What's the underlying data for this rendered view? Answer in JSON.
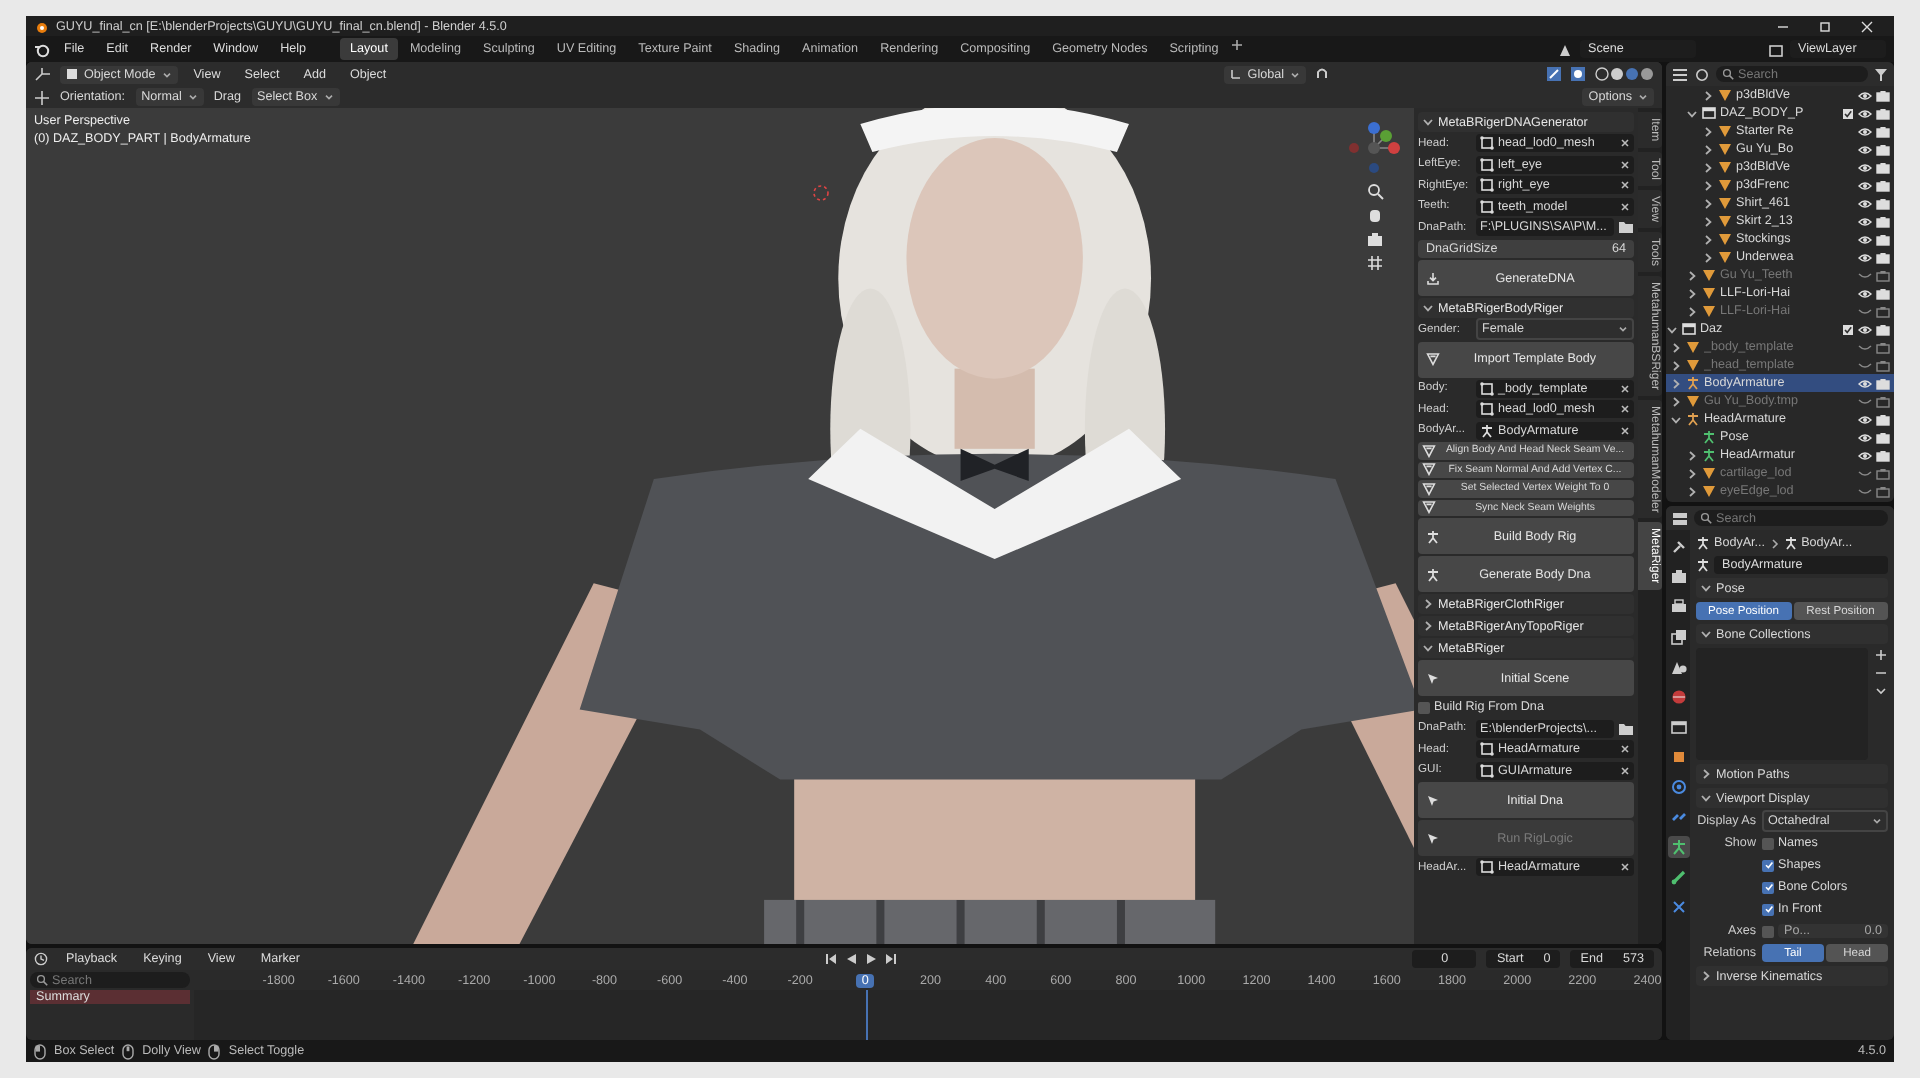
{
  "window": {
    "title": "GUYU_final_cn [E:\\blenderProjects\\GUYU\\GUYU_final_cn.blend] - Blender 4.5.0"
  },
  "menu": [
    "File",
    "Edit",
    "Render",
    "Window",
    "Help"
  ],
  "workspaces": [
    {
      "label": "Layout",
      "selected": true
    },
    {
      "label": "Modeling",
      "selected": false
    },
    {
      "label": "Sculpting",
      "selected": false
    },
    {
      "label": "UV Editing",
      "selected": false
    },
    {
      "label": "Texture Paint",
      "selected": false
    },
    {
      "label": "Shading",
      "selected": false
    },
    {
      "label": "Animation",
      "selected": false
    },
    {
      "label": "Rendering",
      "selected": false
    },
    {
      "label": "Compositing",
      "selected": false
    },
    {
      "label": "Geometry Nodes",
      "selected": false
    },
    {
      "label": "Scripting",
      "selected": false
    }
  ],
  "scene": "Scene",
  "view_layer": "ViewLayer",
  "viewport": {
    "mode": "Object Mode",
    "menus": [
      "View",
      "Select",
      "Add",
      "Object"
    ],
    "orientation": "Global",
    "options": "Options",
    "tool_settings": {
      "orientation_label": "Orientation:",
      "orientation": "Normal",
      "drag_label": "Drag",
      "drag": "Select Box"
    },
    "overlay": [
      "User Perspective",
      "(0) DAZ_BODY_PART | BodyArmature"
    ]
  },
  "side_tabs": [
    {
      "label": "Item",
      "selected": false
    },
    {
      "label": "Tool",
      "selected": false
    },
    {
      "label": "View",
      "selected": false
    },
    {
      "label": "Tools",
      "selected": false
    },
    {
      "label": "MetahumanBSRiger",
      "selected": false
    },
    {
      "label": "MetahumanModeler",
      "selected": false
    },
    {
      "label": "MetaRiger",
      "selected": true
    }
  ],
  "n_panel": [
    {
      "title": "MetaBRigerDNAGenerator",
      "expanded": true,
      "rows": [
        {
          "kind": "mesh_field",
          "label": "Head:",
          "value": "head_lod0_mesh"
        },
        {
          "kind": "mesh_field",
          "label": "LeftEye:",
          "value": "left_eye"
        },
        {
          "kind": "mesh_field",
          "label": "RightEye:",
          "value": "right_eye"
        },
        {
          "kind": "mesh_field",
          "label": "Teeth:",
          "value": "teeth_model"
        },
        {
          "kind": "path",
          "label": "DnaPath:",
          "value": "F:\\PLUGINS\\SA\\P\\M..."
        },
        {
          "kind": "number",
          "label": "DnaGridSize",
          "value": "64"
        },
        {
          "kind": "import_button",
          "label": "GenerateDNA",
          "disabled": false
        }
      ]
    },
    {
      "title": "MetaBRigerBodyRiger",
      "expanded": true,
      "rows": [
        {
          "kind": "dropdown",
          "label": "Gender:",
          "value": "Female"
        },
        {
          "kind": "mesh_button",
          "label": "Import Template Body",
          "disabled": false
        },
        {
          "kind": "mesh_field",
          "label": "Body:",
          "value": "_body_template"
        },
        {
          "kind": "mesh_field",
          "label": "Head:",
          "value": "head_lod0_mesh"
        },
        {
          "kind": "armature_field",
          "label": "BodyAr...",
          "value": "BodyArmature"
        },
        {
          "kind": "small_button",
          "label": "Align Body And Head Neck Seam Ve..."
        },
        {
          "kind": "small_button",
          "label": "Fix Seam Normal And Add Vertex C..."
        },
        {
          "kind": "small_button",
          "label": "Set Selected Vertex Weight To 0"
        },
        {
          "kind": "small_button",
          "label": "Sync Neck Seam Weights"
        },
        {
          "kind": "armature_button",
          "label": "Build Body Rig",
          "disabled": false
        },
        {
          "kind": "armature_button",
          "label": "Generate Body Dna",
          "disabled": false
        }
      ]
    },
    {
      "title": "MetaBRigerClothRiger",
      "expanded": false
    },
    {
      "title": "MetaBRigerAnyTopoRiger",
      "expanded": false
    },
    {
      "title": "MetaBRiger",
      "expanded": true,
      "rows": [
        {
          "kind": "pointer_button",
          "label": "Initial Scene",
          "disabled": false
        },
        {
          "kind": "checkbox",
          "label": "Build Rig From Dna",
          "checked": false
        },
        {
          "kind": "path",
          "label": "DnaPath:",
          "value": "E:\\blenderProjects\\..."
        },
        {
          "kind": "mesh_field",
          "label": "Head:",
          "value": "HeadArmature"
        },
        {
          "kind": "mesh_field",
          "label": "GUI:",
          "value": "GUIArmature"
        },
        {
          "kind": "pointer_button",
          "label": "Initial Dna",
          "disabled": false
        },
        {
          "kind": "pointer_button",
          "label": "Run RigLogic",
          "disabled": true
        },
        {
          "kind": "mesh_field",
          "label": "HeadAr...",
          "value": "HeadArmature"
        }
      ]
    }
  ],
  "outliner": {
    "search_placeholder": "Search",
    "tree": [
      {
        "children": [
          {
            "children": [
              {
                "children": [
                  {
                    "name": "p3dBldVe",
                    "kind": "mesh",
                    "visible": true,
                    "selected": false,
                    "expanded": false
                  }
                ]
              },
              {
                "name": "DAZ_BODY_P",
                "kind": "collection",
                "visible": true,
                "selected": false,
                "expanded": true,
                "children": [
                  {
                    "name": "Starter Re",
                    "kind": "mesh",
                    "visible": true,
                    "selected": false,
                    "expanded": false
                  },
                  {
                    "name": "Gu Yu_Bo",
                    "kind": "mesh",
                    "visible": true,
                    "selected": false,
                    "expanded": false
                  },
                  {
                    "name": "p3dBldVe",
                    "kind": "mesh",
                    "visible": true,
                    "selected": false,
                    "expanded": false
                  },
                  {
                    "name": "p3dFrenc",
                    "kind": "mesh",
                    "visible": true,
                    "selected": false,
                    "expanded": false
                  },
                  {
                    "name": "Shirt_461",
                    "kind": "mesh",
                    "visible": true,
                    "selected": false,
                    "expanded": false
                  },
                  {
                    "name": "Skirt 2_13",
                    "kind": "mesh",
                    "visible": true,
                    "selected": false,
                    "expanded": false
                  },
                  {
                    "name": "Stockings",
                    "kind": "mesh",
                    "visible": true,
                    "selected": false,
                    "expanded": false
                  },
                  {
                    "name": "Underwea",
                    "kind": "mesh",
                    "visible": true,
                    "selected": false,
                    "expanded": false
                  }
                ]
              },
              {
                "name": "Gu Yu_Teeth",
                "kind": "mesh",
                "visible": false,
                "selected": false,
                "expanded": false
              },
              {
                "name": "LLF-Lori-Hai",
                "kind": "mesh",
                "visible": true,
                "selected": false,
                "expanded": false
              },
              {
                "name": "LLF-Lori-Hai",
                "kind": "mesh",
                "visible": false,
                "selected": false,
                "expanded": false
              }
            ]
          }
        ]
      },
      {
        "name": "Daz",
        "kind": "collection",
        "visible": true,
        "selected": false,
        "expanded": true,
        "children": [
          {
            "name": "_body_template",
            "kind": "mesh",
            "visible": false,
            "selected": false,
            "expanded": false
          },
          {
            "name": "_head_template",
            "kind": "mesh",
            "visible": false,
            "selected": false,
            "expanded": false
          },
          {
            "name": "BodyArmature",
            "kind": "armature",
            "visible": true,
            "selected": true,
            "expanded": false
          },
          {
            "name": "Gu Yu_Body.tmp",
            "kind": "mesh",
            "visible": false,
            "selected": false,
            "expanded": false
          },
          {
            "name": "HeadArmature",
            "kind": "armature",
            "visible": true,
            "selected": false,
            "expanded": true,
            "children": [
              {
                "name": "Pose",
                "kind": "pose",
                "visible": true,
                "selected": false
              },
              {
                "name": "HeadArmatur",
                "kind": "pose",
                "visible": true,
                "selected": false,
                "expanded": false
              },
              {
                "name": "cartilage_lod",
                "kind": "mesh",
                "visible": false,
                "selected": false,
                "expanded": false
              },
              {
                "name": "eyeEdge_lod",
                "kind": "mesh",
                "visible": false,
                "selected": false,
                "expanded": false
              }
            ]
          }
        ]
      }
    ]
  },
  "properties": {
    "search_placeholder": "Search",
    "breadcrumb": [
      "BodyAr...",
      "BodyAr..."
    ],
    "name": "BodyArmature",
    "tabs": [
      {
        "kind": "tool",
        "selected": false
      },
      {
        "kind": "render",
        "selected": false
      },
      {
        "kind": "output",
        "selected": false
      },
      {
        "kind": "view_layer",
        "selected": false
      },
      {
        "kind": "scene",
        "selected": false
      },
      {
        "kind": "world",
        "selected": false
      },
      {
        "kind": "collection",
        "selected": false
      },
      {
        "kind": "object",
        "selected": false
      },
      {
        "kind": "physics",
        "selected": false
      },
      {
        "kind": "constraint",
        "selected": false
      },
      {
        "kind": "data",
        "selected": true
      },
      {
        "kind": "bone",
        "selected": false
      },
      {
        "kind": "bone_constraint",
        "selected": false
      }
    ],
    "sections": [
      {
        "title": "Pose",
        "expanded": true,
        "kind": "segmented",
        "options": [
          {
            "label": "Pose Position",
            "selected": true
          },
          {
            "label": "Rest Position",
            "selected": false
          }
        ]
      },
      {
        "title": "Bone Collections",
        "expanded": true,
        "kind": "list"
      },
      {
        "title": "Motion Paths",
        "expanded": false
      },
      {
        "title": "Viewport Display",
        "expanded": true,
        "kind": "rows",
        "rows": [
          {
            "kind": "dropdown",
            "label": "Display As",
            "value": "Octahedral"
          },
          {
            "kind": "checkbox",
            "label": "Show",
            "text": "Names",
            "checked": false
          },
          {
            "kind": "checkbox",
            "text": "Shapes",
            "checked": true
          },
          {
            "kind": "checkbox",
            "text": "Bone Colors",
            "checked": true
          },
          {
            "kind": "checkbox",
            "text": "In Front",
            "checked": true
          },
          {
            "kind": "axes",
            "label": "Axes",
            "checked": false,
            "field": "Po...",
            "value": "0.0"
          },
          {
            "kind": "segmented",
            "label": "Relations",
            "options": [
              {
                "label": "Tail",
                "selected": true
              },
              {
                "label": "Head",
                "selected": false
              }
            ]
          }
        ]
      },
      {
        "title": "Inverse Kinematics",
        "expanded": false
      }
    ]
  },
  "timeline": {
    "menus": [
      "Playback",
      "Keying",
      "View",
      "Marker"
    ],
    "frame": "0",
    "start_label": "Start",
    "start": "0",
    "end_label": "End",
    "end": "573",
    "search_placeholder": "Search",
    "channel": "Summary",
    "ticks": [
      {
        "label": "-1800",
        "current": false
      },
      {
        "label": "-1600",
        "current": false
      },
      {
        "label": "-1400",
        "current": false
      },
      {
        "label": "-1200",
        "current": false
      },
      {
        "label": "-1000",
        "current": false
      },
      {
        "label": "-800",
        "current": false
      },
      {
        "label": "-600",
        "current": false
      },
      {
        "label": "-400",
        "current": false
      },
      {
        "label": "-200",
        "current": false
      },
      {
        "label": "0",
        "current": true
      },
      {
        "label": "200",
        "current": false
      },
      {
        "label": "400",
        "current": false
      },
      {
        "label": "600",
        "current": false
      },
      {
        "label": "800",
        "current": false
      },
      {
        "label": "1000",
        "current": false
      },
      {
        "label": "1200",
        "current": false
      },
      {
        "label": "1400",
        "current": false
      },
      {
        "label": "1600",
        "current": false
      },
      {
        "label": "1800",
        "current": false
      },
      {
        "label": "2000",
        "current": false
      },
      {
        "label": "2200",
        "current": false
      },
      {
        "label": "2400",
        "current": false
      }
    ]
  },
  "status_bar": {
    "hints": [
      "Box Select",
      "Dolly View",
      "Select Toggle"
    ],
    "version": "4.5.0"
  }
}
